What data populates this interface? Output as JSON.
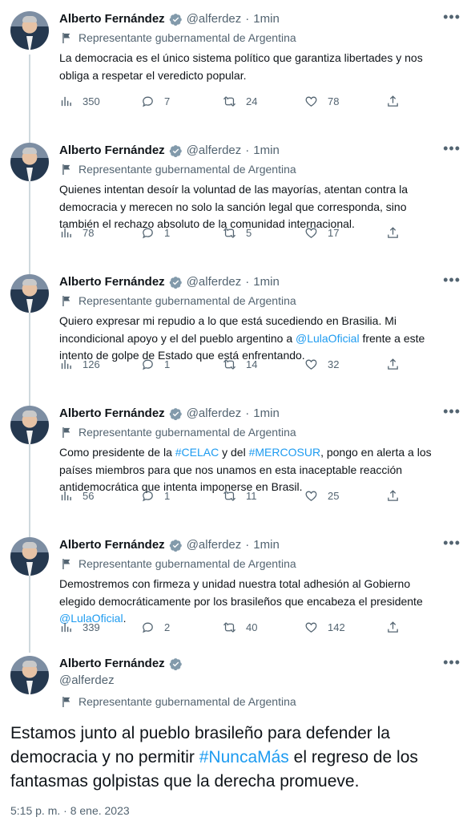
{
  "author": {
    "name": "Alberto Fernández",
    "handle": "@alferdez",
    "label": "Representante gubernamental de Argentina"
  },
  "thread": [
    {
      "time": "1min",
      "lines": [
        "La democracia es el único sistema político que garantiza libertades y nos",
        "obliga a respetar el veredicto popular."
      ],
      "views": "350",
      "replies": "7",
      "retweets": "24",
      "likes": "78"
    },
    {
      "time": "1min",
      "lines": [
        "Quienes intentan desoír la voluntad de las mayorías, atentan contra la",
        "democracia y merecen no solo la sanción legal que corresponda, sino",
        "también el rechazo absoluto de la comunidad internacional."
      ],
      "views": "78",
      "replies": "1",
      "retweets": "5",
      "likes": "17"
    },
    {
      "time": "1min",
      "lines": [
        "Quiero expresar mi repudio a lo que está sucediendo en Brasilia. Mi",
        "incondicional apoyo y el del pueblo argentino a ",
        "@LulaOficial",
        " frente a este",
        "intento de golpe de Estado que está enfrentando."
      ],
      "views": "126",
      "replies": "1",
      "retweets": "14",
      "likes": "32"
    },
    {
      "time": "1min",
      "lines": [
        "Como presidente de la ",
        "#CELAC",
        " y del ",
        "#MERCOSUR",
        ", pongo en alerta a los",
        "países miembros para que nos unamos en esta inaceptable reacción",
        "antidemocrática que intenta imponerse en Brasil."
      ],
      "views": "56",
      "replies": "1",
      "retweets": "11",
      "likes": "25"
    },
    {
      "time": "1min",
      "lines": [
        "Demostremos con firmeza y unidad nuestra total adhesión al Gobierno",
        "elegido democráticamente por los brasileños que encabeza el presidente",
        "@LulaOficial",
        "."
      ],
      "views": "339",
      "replies": "2",
      "retweets": "40",
      "likes": "142"
    }
  ],
  "main": {
    "text_before": "Estamos junto al pueblo brasileño para defender la democracia y no permitir ",
    "hashtag": "#NuncaMás",
    "text_after": " el regreso de los fantasmas golpistas que la derecha promueve.",
    "timestamp": "5:15 p. m. · 8 ene. 2023"
  },
  "icons": {
    "verified": "verified-badge-icon",
    "flag": "government-flag-icon",
    "views": "views-icon",
    "reply": "reply-icon",
    "retweet": "retweet-icon",
    "like": "like-icon",
    "share": "share-icon",
    "more": "more-options-icon"
  },
  "colors": {
    "accent": "#1d9bf0",
    "text": "#0f1419",
    "muted": "#536471",
    "thread_line": "#cfd9de"
  }
}
